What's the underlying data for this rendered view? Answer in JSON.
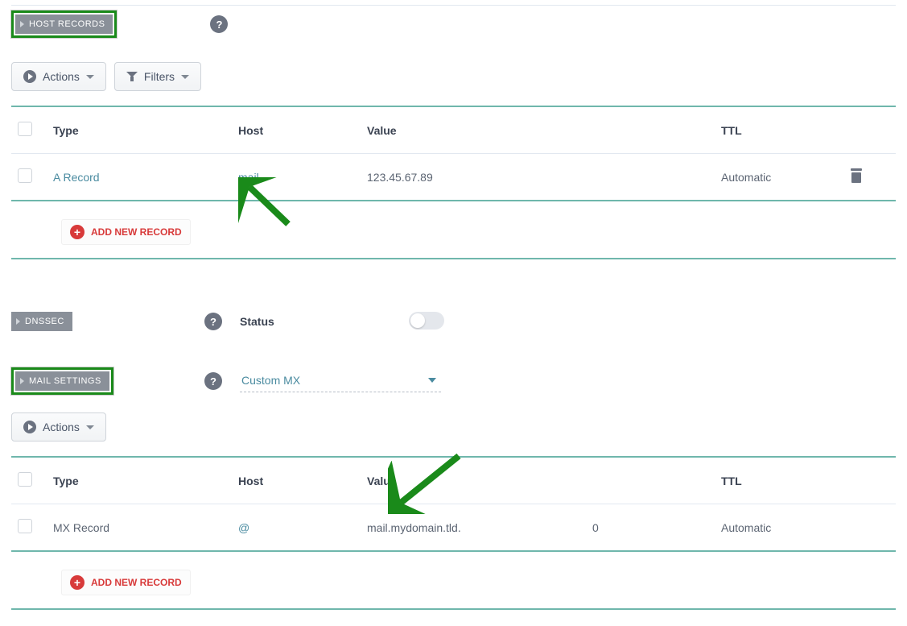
{
  "sections": {
    "host_records_title": "HOST RECORDS",
    "dnssec_title": "DNSSEC",
    "mail_settings_title": "MAIL SETTINGS"
  },
  "toolbar": {
    "actions_label": "Actions",
    "filters_label": "Filters"
  },
  "columns": {
    "type": "Type",
    "host": "Host",
    "value": "Value",
    "ttl": "TTL"
  },
  "host_records": [
    {
      "type": "A Record",
      "host": "mail",
      "value": "123.45.67.89",
      "ttl": "Automatic"
    }
  ],
  "add_new_record_label": "ADD NEW RECORD",
  "dnssec": {
    "status_label": "Status",
    "enabled": false
  },
  "mail_settings": {
    "selected": "Custom MX"
  },
  "mail_records": [
    {
      "type": "MX Record",
      "host": "@",
      "value": "mail.mydomain.tld.",
      "priority": "0",
      "ttl": "Automatic"
    }
  ]
}
